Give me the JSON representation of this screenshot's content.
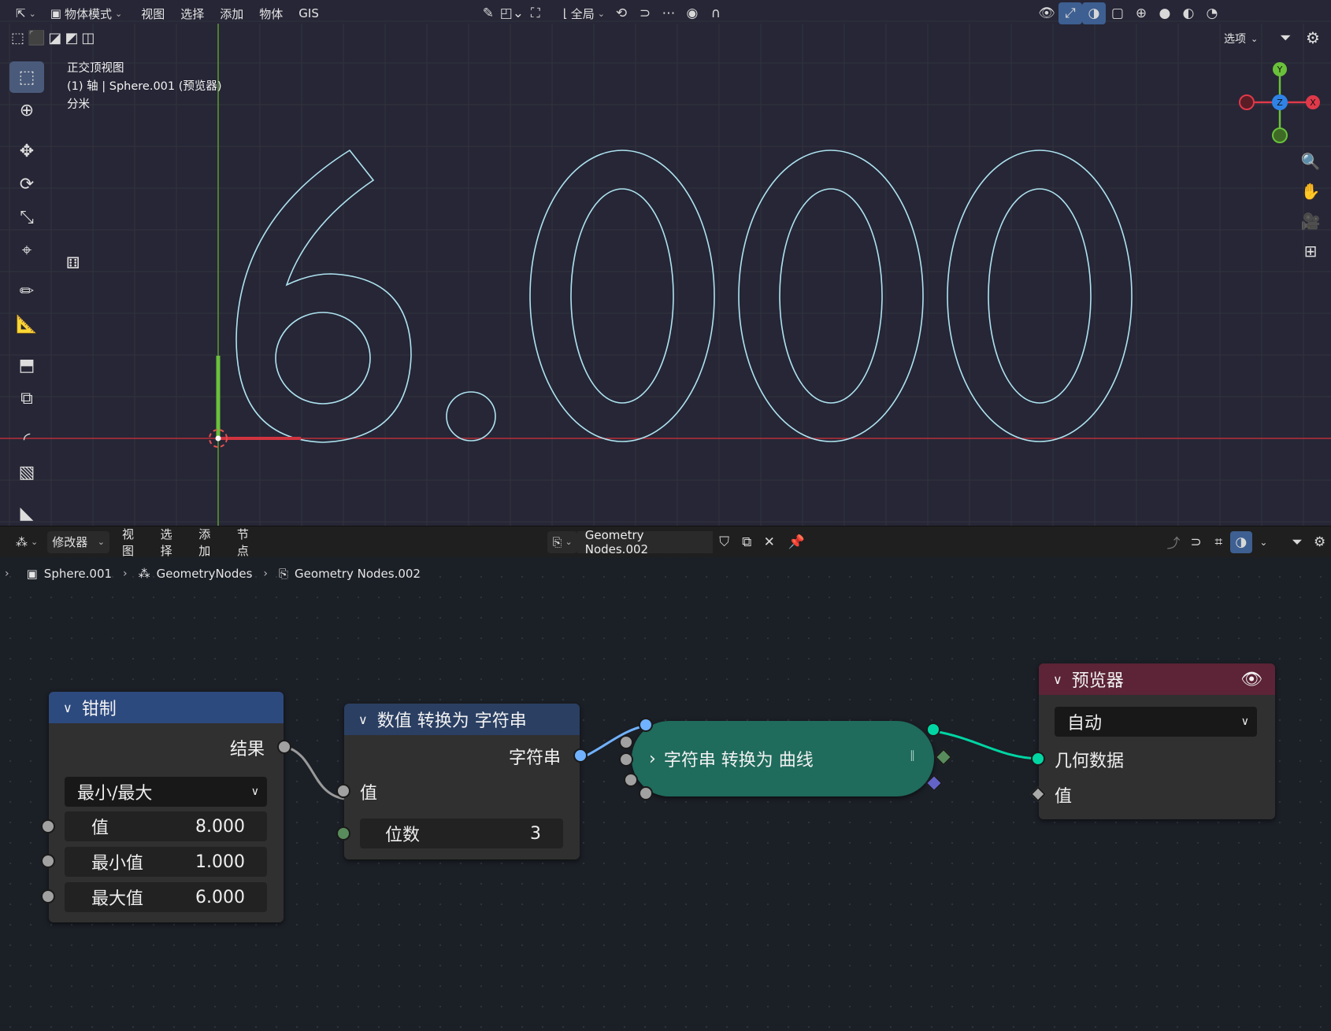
{
  "viewport": {
    "header": {
      "mode_label": "物体模式",
      "menus": [
        "视图",
        "选择",
        "添加",
        "物体",
        "GIS"
      ],
      "transform_orientation": "全局",
      "options_label": "选项"
    },
    "info": {
      "view_name": "正交顶视图",
      "object_line": "(1) 轴 | Sphere.001 (预览器)",
      "units": "分米"
    },
    "text_object": "6.000",
    "gizmo": {
      "y_label": "Y",
      "z_label": "Z",
      "x_label": "X"
    }
  },
  "node_editor": {
    "header": {
      "editor_type_label": "修改器",
      "menus": [
        "视图",
        "选择",
        "添加",
        "节点"
      ],
      "node_group_name": "Geometry Nodes.002"
    },
    "breadcrumb": [
      "Sphere.001",
      "GeometryNodes",
      "Geometry Nodes.002"
    ],
    "nodes": {
      "clamp": {
        "title": "钳制",
        "output_label": "结果",
        "mode": "最小/最大",
        "inputs": [
          {
            "label": "值",
            "value": "8.000"
          },
          {
            "label": "最小值",
            "value": "1.000"
          },
          {
            "label": "最大值",
            "value": "6.000"
          }
        ],
        "color": "#2d4a7f"
      },
      "value_to_string": {
        "title": "数值 转换为 字符串",
        "output_label": "字符串",
        "input_label": "值",
        "decimals_label": "位数",
        "decimals_value": "3",
        "color": "#2a3f62"
      },
      "string_to_curves": {
        "title": "字符串 转换为 曲线",
        "color": "#1f6b5c"
      },
      "viewer": {
        "title": "预览器",
        "domain": "自动",
        "geometry_label": "几何数据",
        "value_label": "值",
        "color": "#5c2436"
      }
    }
  },
  "colors": {
    "geometry_socket": "#00d6a3",
    "string_socket": "#70b2ff",
    "float_socket": "#a1a1a1",
    "int_socket": "#598c5c",
    "curve_outline": "#aee3f0",
    "x_axis": "#d0343f",
    "y_axis": "#6ac13a"
  }
}
